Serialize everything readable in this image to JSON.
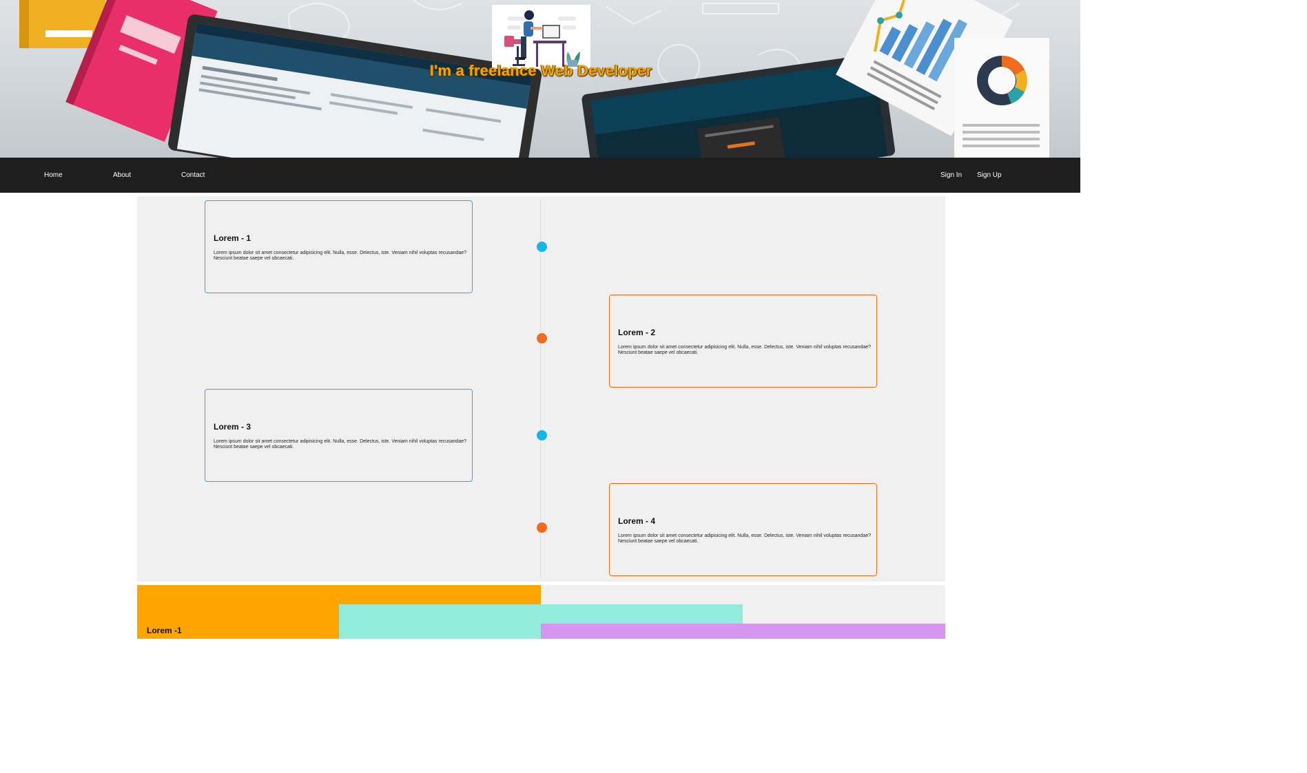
{
  "hero": {
    "title": "I'm a freelance Web Developer",
    "logo_icon": "developer-at-desk-illustration",
    "background_icon": "office-desk-computers-illustration"
  },
  "nav": {
    "left_links": [
      "Home",
      "About",
      "Contact"
    ],
    "right_links": [
      "Sign In",
      "Sign Up"
    ]
  },
  "timeline": {
    "items": [
      {
        "title": "Lorem - 1",
        "text": "Lorem ipsum dolor sit amet consectetur adipisicing elit. Nulla, esse. Delectus, iste. Veniam nihil voluptas recusandae? Nesciunt beatae saepe vel obcaecati.",
        "side": "left",
        "accent": "#13b6e8"
      },
      {
        "title": "Lorem - 2",
        "text": "Lorem ipsum dolor sit amet consectetur adipisicing elit. Nulla, esse. Delectus, iste. Veniam nihil voluptas recusandae? Nesciunt beatae saepe vel obcaecati.",
        "side": "right",
        "accent": "#f26a1b"
      },
      {
        "title": "Lorem - 3",
        "text": "Lorem ipsum dolor sit amet consectetur adipisicing elit. Nulla, esse. Delectus, iste. Veniam nihil voluptas recusandae? Nesciunt beatae saepe vel obcaecati.",
        "side": "left",
        "accent": "#13b6e8"
      },
      {
        "title": "Lorem - 4",
        "text": "Lorem ipsum dolor sit amet consectetur adipisicing elit. Nulla, esse. Delectus, iste. Veniam nihil voluptas recusandae? Nesciunt beatae saepe vel obcaecati.",
        "side": "right",
        "accent": "#f26a1b"
      }
    ]
  },
  "blocks": {
    "first_title": "Lorem -1",
    "colors": [
      "#ffa500",
      "#91ecdc",
      "#d696ef"
    ]
  },
  "colors": {
    "nav_bg": "#1e1e1e",
    "timeline_bg": "#f0f0f0",
    "title_orange": "#f4a300",
    "accent_blue": "#13b6e8",
    "accent_orange": "#f26a1b"
  }
}
